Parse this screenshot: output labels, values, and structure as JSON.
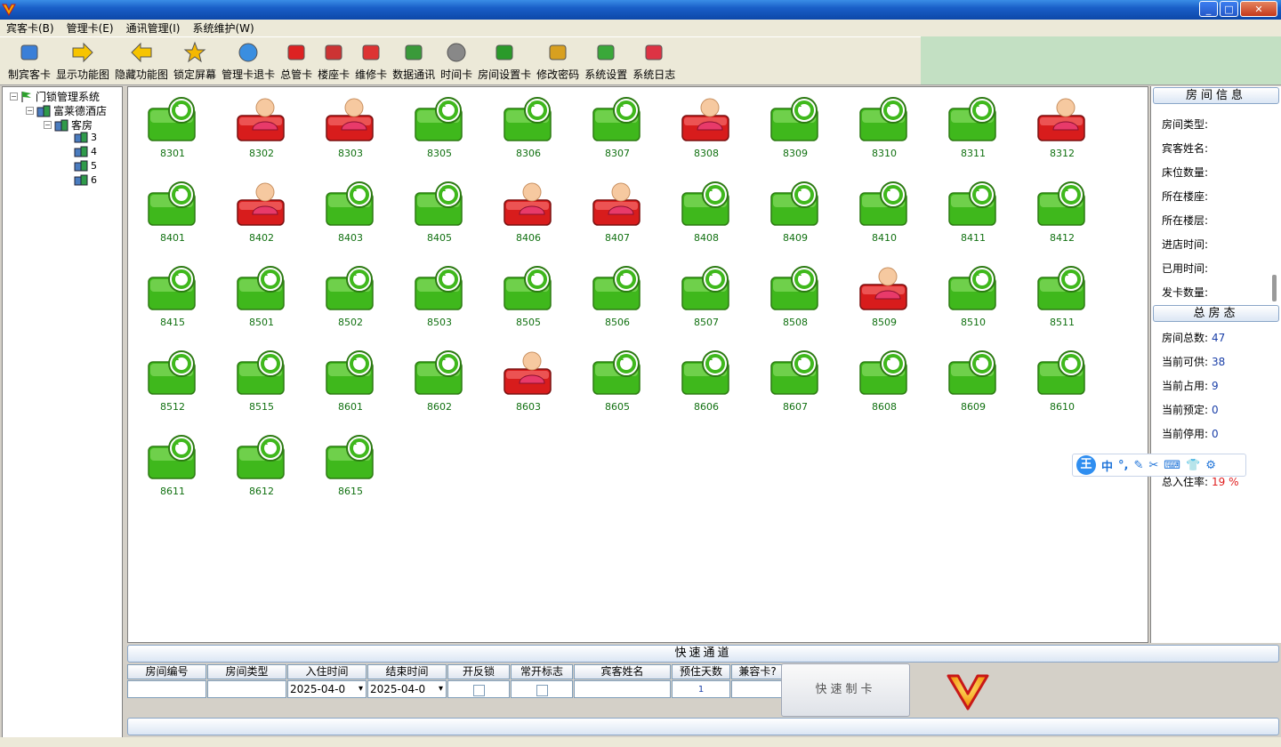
{
  "menu": [
    "宾客卡(B)",
    "管理卡(E)",
    "通讯管理(I)",
    "系统维护(W)"
  ],
  "window_buttons": [
    "_",
    "□",
    "✕"
  ],
  "toolbar": [
    {
      "label": "制宾客卡",
      "icon": "guests-icon"
    },
    {
      "label": "显示功能图",
      "icon": "arrow-right-icon"
    },
    {
      "label": "隐藏功能图",
      "icon": "arrow-left-icon"
    },
    {
      "label": "锁定屏幕",
      "icon": "star-lock-icon"
    },
    {
      "label": "管理卡退卡",
      "icon": "globe-card-icon"
    },
    {
      "label": "总管卡",
      "icon": "master-card-icon"
    },
    {
      "label": "楼座卡",
      "icon": "building-card-icon"
    },
    {
      "label": "维修卡",
      "icon": "house-repair-icon"
    },
    {
      "label": "数据通讯",
      "icon": "data-comm-icon"
    },
    {
      "label": "时间卡",
      "icon": "clock-icon"
    },
    {
      "label": "房间设置卡",
      "icon": "room-setting-icon"
    },
    {
      "label": "修改密码",
      "icon": "users-password-icon"
    },
    {
      "label": "系统设置",
      "icon": "gears-icon"
    },
    {
      "label": "系统日志",
      "icon": "log-icon"
    }
  ],
  "tree": {
    "root": "门锁管理系统",
    "hotel": "富莱德酒店",
    "category": "客房",
    "floors": [
      "3",
      "4",
      "5",
      "6"
    ]
  },
  "rooms": [
    {
      "n": "8301",
      "s": "vacant"
    },
    {
      "n": "8302",
      "s": "occupied"
    },
    {
      "n": "8303",
      "s": "occupied"
    },
    {
      "n": "8305",
      "s": "vacant"
    },
    {
      "n": "8306",
      "s": "vacant"
    },
    {
      "n": "8307",
      "s": "vacant"
    },
    {
      "n": "8308",
      "s": "occupied"
    },
    {
      "n": "8309",
      "s": "vacant"
    },
    {
      "n": "8310",
      "s": "vacant"
    },
    {
      "n": "8311",
      "s": "vacant"
    },
    {
      "n": "8312",
      "s": "occupied"
    },
    {
      "n": "8401",
      "s": "vacant"
    },
    {
      "n": "8402",
      "s": "occupied"
    },
    {
      "n": "8403",
      "s": "vacant"
    },
    {
      "n": "8405",
      "s": "vacant"
    },
    {
      "n": "8406",
      "s": "occupied"
    },
    {
      "n": "8407",
      "s": "occupied"
    },
    {
      "n": "8408",
      "s": "vacant"
    },
    {
      "n": "8409",
      "s": "vacant"
    },
    {
      "n": "8410",
      "s": "vacant"
    },
    {
      "n": "8411",
      "s": "vacant"
    },
    {
      "n": "8412",
      "s": "vacant"
    },
    {
      "n": "8415",
      "s": "vacant"
    },
    {
      "n": "8501",
      "s": "vacant"
    },
    {
      "n": "8502",
      "s": "vacant"
    },
    {
      "n": "8503",
      "s": "vacant"
    },
    {
      "n": "8505",
      "s": "vacant"
    },
    {
      "n": "8506",
      "s": "vacant"
    },
    {
      "n": "8507",
      "s": "vacant"
    },
    {
      "n": "8508",
      "s": "vacant"
    },
    {
      "n": "8509",
      "s": "occupied"
    },
    {
      "n": "8510",
      "s": "vacant"
    },
    {
      "n": "8511",
      "s": "vacant"
    },
    {
      "n": "8512",
      "s": "vacant"
    },
    {
      "n": "8515",
      "s": "vacant"
    },
    {
      "n": "8601",
      "s": "vacant"
    },
    {
      "n": "8602",
      "s": "vacant"
    },
    {
      "n": "8603",
      "s": "occupied"
    },
    {
      "n": "8605",
      "s": "vacant"
    },
    {
      "n": "8606",
      "s": "vacant"
    },
    {
      "n": "8607",
      "s": "vacant"
    },
    {
      "n": "8608",
      "s": "vacant"
    },
    {
      "n": "8609",
      "s": "vacant"
    },
    {
      "n": "8610",
      "s": "vacant"
    },
    {
      "n": "8611",
      "s": "vacant"
    },
    {
      "n": "8612",
      "s": "vacant"
    },
    {
      "n": "8615",
      "s": "vacant"
    }
  ],
  "status_colors": {
    "vacant": "#3fb81c",
    "occupied": "#d81c1c"
  },
  "room_info": {
    "header": "房间信息",
    "fields": [
      "房间类型:",
      "宾客姓名:",
      "床位数量:",
      "所在楼座:",
      "所在楼层:",
      "进店时间:",
      "已用时间:",
      "发卡数量:"
    ]
  },
  "summary": {
    "header": "总房态",
    "rows": [
      {
        "label": "房间总数:",
        "value": "47"
      },
      {
        "label": "当前可供:",
        "value": "38"
      },
      {
        "label": "当前占用:",
        "value": "9"
      },
      {
        "label": "当前预定:",
        "value": "0"
      },
      {
        "label": "当前停用:",
        "value": "0"
      }
    ],
    "occupancy_label": "总入住率:",
    "occupancy_value": "19 %"
  },
  "ime": {
    "logo": "王",
    "mode": "中"
  },
  "quick": {
    "title": "快速通道",
    "columns": [
      "房间编号",
      "房间类型",
      "入住时间",
      "结束时间",
      "开反锁",
      "常开标志",
      "宾客姓名",
      "预住天数",
      "兼容卡?"
    ],
    "checkin_date": "2025-04-0",
    "checkout_date": "2025-04-0",
    "days": "1",
    "button": "快速制卡"
  }
}
